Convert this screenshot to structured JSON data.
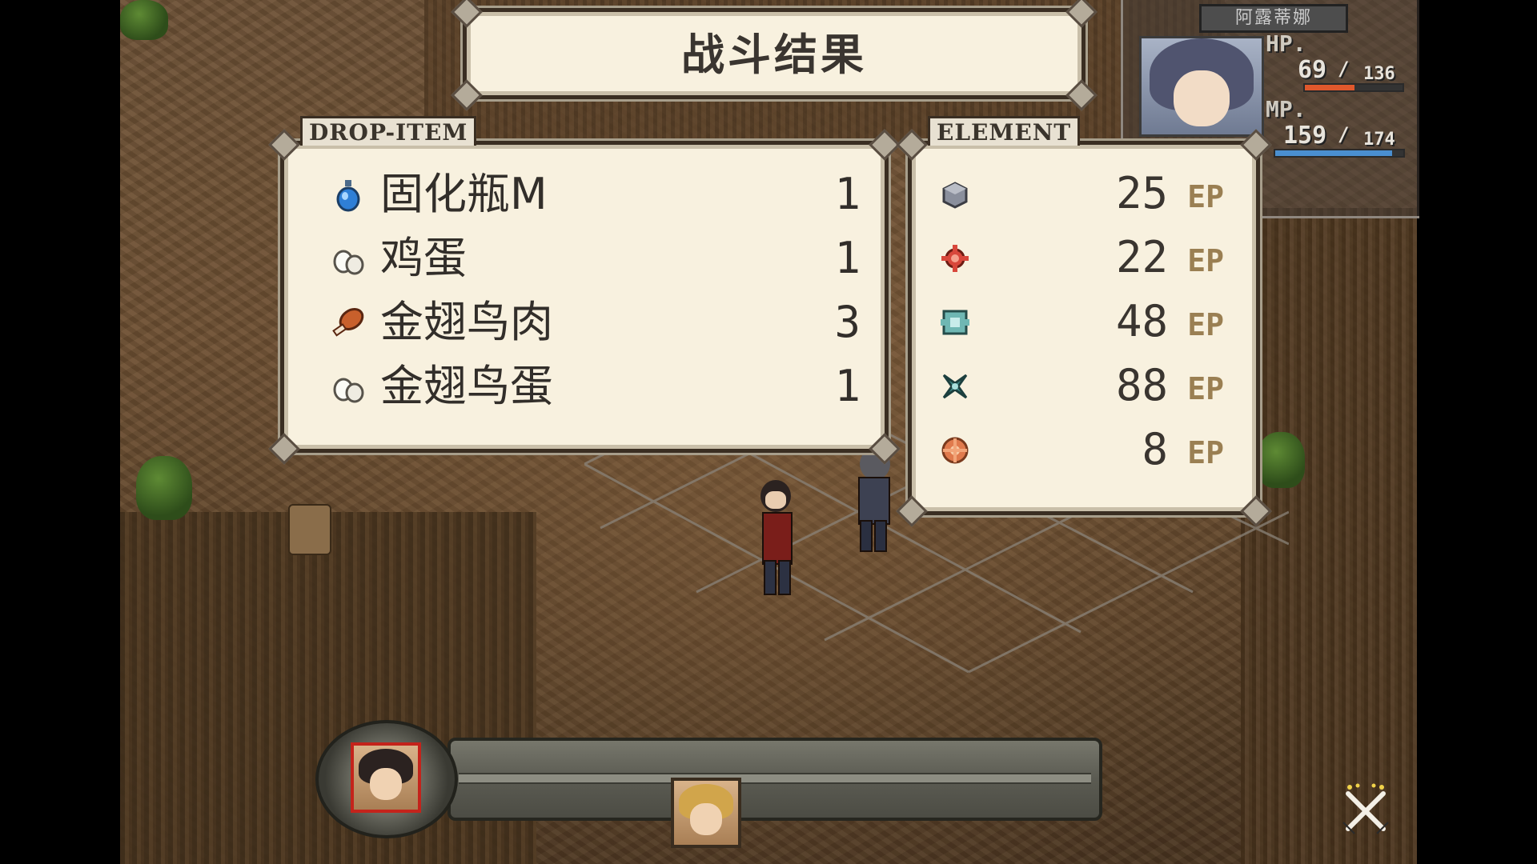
{
  "title": "战斗结果",
  "drop_panel": {
    "label": "DROP-ITEM",
    "items": [
      {
        "name": "固化瓶M",
        "qty": "1",
        "icon": "potion-icon"
      },
      {
        "name": "鸡蛋",
        "qty": "1",
        "icon": "egg-icon"
      },
      {
        "name": "金翅鸟肉",
        "qty": "3",
        "icon": "meat-icon"
      },
      {
        "name": "金翅鸟蛋",
        "qty": "1",
        "icon": "egg-icon"
      }
    ]
  },
  "element_panel": {
    "label": "ELEMENT",
    "unit": "EP",
    "items": [
      {
        "value": "25",
        "icon": "earth-element-icon",
        "color": "#8a8f9c"
      },
      {
        "value": "22",
        "icon": "fire-element-icon",
        "color": "#d8473b"
      },
      {
        "value": "48",
        "icon": "wind-element-icon",
        "color": "#6fb7b3"
      },
      {
        "value": "88",
        "icon": "water-element-icon",
        "color": "#3f8c8a"
      },
      {
        "value": "8",
        "icon": "light-element-icon",
        "color": "#e07a4d"
      }
    ]
  },
  "party": {
    "name": "阿露蒂娜",
    "hp_label": "HP.",
    "hp_current": "69",
    "hp_max": "136",
    "hp_fraction": 0.51,
    "mp_label": "MP.",
    "mp_current": "159",
    "mp_max": "174",
    "mp_fraction": 0.91,
    "hp_color": "#e0582c",
    "mp_color": "#4a8fd0"
  },
  "colors": {
    "panel_bg": "#f8f1df",
    "panel_border": "#3a2e22",
    "text": "#322e2a",
    "ep_unit": "#9a7f52"
  }
}
